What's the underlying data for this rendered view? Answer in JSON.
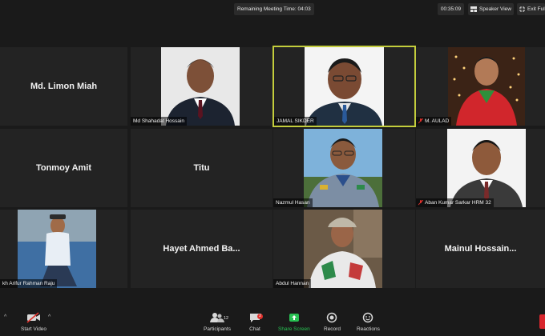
{
  "meeting": {
    "remaining_label": "Remaining Meeting Time: 04:03",
    "elapsed_time": "00:35:09",
    "speaker_view_label": "Speaker View",
    "exit_fullscreen_label": "Exit Full Screen"
  },
  "participants": [
    {
      "name": "Md. Limon Miah",
      "video": false,
      "muted": false
    },
    {
      "name": "Md Shahadat Hossain",
      "video": true,
      "muted": false
    },
    {
      "name": "JAMAL SIKDER",
      "video": true,
      "muted": false,
      "active_speaker": true
    },
    {
      "name": "M. AULAD",
      "video": true,
      "muted": true
    },
    {
      "name": "Tonmoy Amit",
      "video": false,
      "muted": false
    },
    {
      "name": "Titu",
      "video": false,
      "muted": false
    },
    {
      "name": "Nazmul Hasan",
      "video": true,
      "muted": false
    },
    {
      "name": "Aban Kumar Sarkar HRM 32",
      "video": true,
      "muted": true
    },
    {
      "name": "kh Arifur Rahman Raju",
      "video": true,
      "muted": false
    },
    {
      "name": "Hayet Ahmed Ba...",
      "video": false,
      "muted": false
    },
    {
      "name": "Abdul Hannan",
      "video": true,
      "muted": false
    },
    {
      "name": "Mainul Hossain...",
      "video": false,
      "muted": false
    }
  ],
  "toolbar": {
    "start_video": "Start Video",
    "participants": "Participants",
    "participants_count": "12",
    "chat": "Chat",
    "chat_badge": "2",
    "share_screen": "Share Screen",
    "record": "Record",
    "reactions": "Reactions"
  },
  "colors": {
    "active_speaker_border": "#c3cd3c",
    "share_screen_green": "#27c152",
    "badge_red": "#e0312c",
    "tile_bg": "#232323",
    "window_bg": "#1a1a1a"
  }
}
